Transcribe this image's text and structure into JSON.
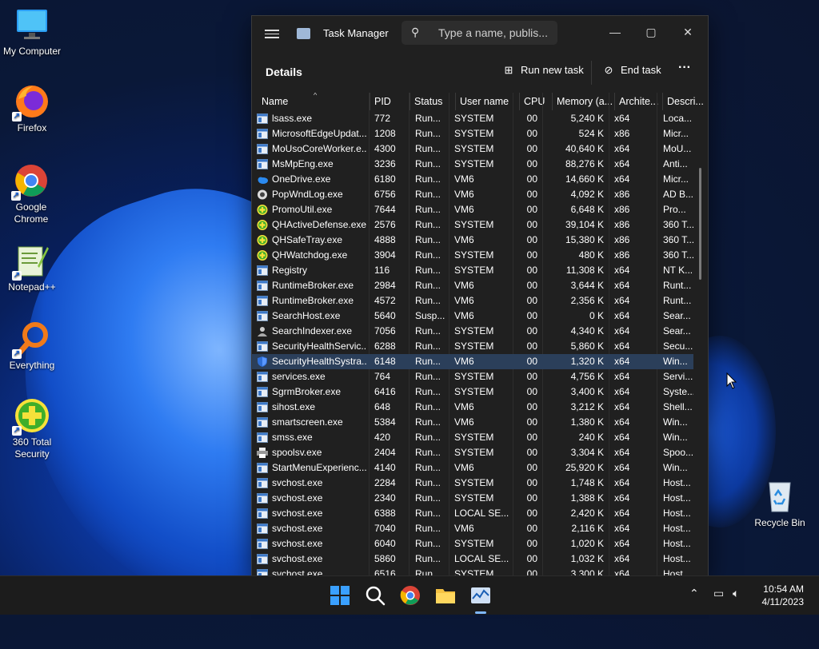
{
  "desktop": {
    "icons": [
      {
        "label": "My Computer"
      },
      {
        "label": "Firefox"
      },
      {
        "label": "Google Chrome"
      },
      {
        "label": "Notepad++"
      },
      {
        "label": "Everything"
      },
      {
        "label": "360 Total Security"
      },
      {
        "label": "Recycle Bin"
      }
    ]
  },
  "window": {
    "title": "Task Manager",
    "search_placeholder": "Type a name, publis...",
    "page_title": "Details",
    "run_new_task": "Run new task",
    "end_task": "End task",
    "more": "···",
    "minimize": "—",
    "maximize": "▢",
    "close": "✕"
  },
  "columns": [
    "Name",
    "PID",
    "Status",
    "User name",
    "CPU",
    "Memory (a...",
    "Archite...",
    "Descri..."
  ],
  "rows": [
    {
      "icon": "window",
      "name": "lsass.exe",
      "pid": "772",
      "status": "Run...",
      "user": "SYSTEM",
      "cpu": "00",
      "mem": "5,240 K",
      "arch": "x64",
      "desc": "Loca..."
    },
    {
      "icon": "window",
      "name": "MicrosoftEdgeUpdat...",
      "pid": "1208",
      "status": "Run...",
      "user": "SYSTEM",
      "cpu": "00",
      "mem": "524 K",
      "arch": "x86",
      "desc": "Micr..."
    },
    {
      "icon": "window",
      "name": "MoUsoCoreWorker.e...",
      "pid": "4300",
      "status": "Run...",
      "user": "SYSTEM",
      "cpu": "00",
      "mem": "40,640 K",
      "arch": "x64",
      "desc": "MoU..."
    },
    {
      "icon": "window",
      "name": "MsMpEng.exe",
      "pid": "3236",
      "status": "Run...",
      "user": "SYSTEM",
      "cpu": "00",
      "mem": "88,276 K",
      "arch": "x64",
      "desc": "Anti..."
    },
    {
      "icon": "cloud",
      "name": "OneDrive.exe",
      "pid": "6180",
      "status": "Run...",
      "user": "VM6",
      "cpu": "00",
      "mem": "14,660 K",
      "arch": "x64",
      "desc": "Micr..."
    },
    {
      "icon": "gear",
      "name": "PopWndLog.exe",
      "pid": "6756",
      "status": "Run...",
      "user": "VM6",
      "cpu": "00",
      "mem": "4,092 K",
      "arch": "x86",
      "desc": "AD B..."
    },
    {
      "icon": "plus",
      "name": "PromoUtil.exe",
      "pid": "7644",
      "status": "Run...",
      "user": "VM6",
      "cpu": "00",
      "mem": "6,648 K",
      "arch": "x86",
      "desc": "Pro..."
    },
    {
      "icon": "plus",
      "name": "QHActiveDefense.exe",
      "pid": "2576",
      "status": "Run...",
      "user": "SYSTEM",
      "cpu": "00",
      "mem": "39,104 K",
      "arch": "x86",
      "desc": "360 T..."
    },
    {
      "icon": "plus",
      "name": "QHSafeTray.exe",
      "pid": "4888",
      "status": "Run...",
      "user": "VM6",
      "cpu": "00",
      "mem": "15,380 K",
      "arch": "x86",
      "desc": "360 T..."
    },
    {
      "icon": "plus",
      "name": "QHWatchdog.exe",
      "pid": "3904",
      "status": "Run...",
      "user": "SYSTEM",
      "cpu": "00",
      "mem": "480 K",
      "arch": "x86",
      "desc": "360 T..."
    },
    {
      "icon": "window",
      "name": "Registry",
      "pid": "116",
      "status": "Run...",
      "user": "SYSTEM",
      "cpu": "00",
      "mem": "11,308 K",
      "arch": "x64",
      "desc": "NT K..."
    },
    {
      "icon": "window",
      "name": "RuntimeBroker.exe",
      "pid": "2984",
      "status": "Run...",
      "user": "VM6",
      "cpu": "00",
      "mem": "3,644 K",
      "arch": "x64",
      "desc": "Runt..."
    },
    {
      "icon": "window",
      "name": "RuntimeBroker.exe",
      "pid": "4572",
      "status": "Run...",
      "user": "VM6",
      "cpu": "00",
      "mem": "2,356 K",
      "arch": "x64",
      "desc": "Runt..."
    },
    {
      "icon": "window",
      "name": "SearchHost.exe",
      "pid": "5640",
      "status": "Susp...",
      "user": "VM6",
      "cpu": "00",
      "mem": "0 K",
      "arch": "x64",
      "desc": "Sear..."
    },
    {
      "icon": "person",
      "name": "SearchIndexer.exe",
      "pid": "7056",
      "status": "Run...",
      "user": "SYSTEM",
      "cpu": "00",
      "mem": "4,340 K",
      "arch": "x64",
      "desc": "Sear..."
    },
    {
      "icon": "window",
      "name": "SecurityHealthServic...",
      "pid": "6288",
      "status": "Run...",
      "user": "SYSTEM",
      "cpu": "00",
      "mem": "5,860 K",
      "arch": "x64",
      "desc": "Secu..."
    },
    {
      "icon": "shield",
      "name": "SecurityHealthSystra...",
      "pid": "6148",
      "status": "Run...",
      "user": "VM6",
      "cpu": "00",
      "mem": "1,320 K",
      "arch": "x64",
      "desc": "Win...",
      "selected": true
    },
    {
      "icon": "window",
      "name": "services.exe",
      "pid": "764",
      "status": "Run...",
      "user": "SYSTEM",
      "cpu": "00",
      "mem": "4,756 K",
      "arch": "x64",
      "desc": "Servi..."
    },
    {
      "icon": "window",
      "name": "SgrmBroker.exe",
      "pid": "6416",
      "status": "Run...",
      "user": "SYSTEM",
      "cpu": "00",
      "mem": "3,400 K",
      "arch": "x64",
      "desc": "Syste..."
    },
    {
      "icon": "window",
      "name": "sihost.exe",
      "pid": "648",
      "status": "Run...",
      "user": "VM6",
      "cpu": "00",
      "mem": "3,212 K",
      "arch": "x64",
      "desc": "Shell..."
    },
    {
      "icon": "window",
      "name": "smartscreen.exe",
      "pid": "5384",
      "status": "Run...",
      "user": "VM6",
      "cpu": "00",
      "mem": "1,380 K",
      "arch": "x64",
      "desc": "Win..."
    },
    {
      "icon": "window",
      "name": "smss.exe",
      "pid": "420",
      "status": "Run...",
      "user": "SYSTEM",
      "cpu": "00",
      "mem": "240 K",
      "arch": "x64",
      "desc": "Win..."
    },
    {
      "icon": "printer",
      "name": "spoolsv.exe",
      "pid": "2404",
      "status": "Run...",
      "user": "SYSTEM",
      "cpu": "00",
      "mem": "3,304 K",
      "arch": "x64",
      "desc": "Spoo..."
    },
    {
      "icon": "window",
      "name": "StartMenuExperienc...",
      "pid": "4140",
      "status": "Run...",
      "user": "VM6",
      "cpu": "00",
      "mem": "25,920 K",
      "arch": "x64",
      "desc": "Win..."
    },
    {
      "icon": "window",
      "name": "svchost.exe",
      "pid": "2284",
      "status": "Run...",
      "user": "SYSTEM",
      "cpu": "00",
      "mem": "1,748 K",
      "arch": "x64",
      "desc": "Host..."
    },
    {
      "icon": "window",
      "name": "svchost.exe",
      "pid": "2340",
      "status": "Run...",
      "user": "SYSTEM",
      "cpu": "00",
      "mem": "1,388 K",
      "arch": "x64",
      "desc": "Host..."
    },
    {
      "icon": "window",
      "name": "svchost.exe",
      "pid": "6388",
      "status": "Run...",
      "user": "LOCAL SE...",
      "cpu": "00",
      "mem": "2,420 K",
      "arch": "x64",
      "desc": "Host..."
    },
    {
      "icon": "window",
      "name": "svchost.exe",
      "pid": "7040",
      "status": "Run...",
      "user": "VM6",
      "cpu": "00",
      "mem": "2,116 K",
      "arch": "x64",
      "desc": "Host..."
    },
    {
      "icon": "window",
      "name": "svchost.exe",
      "pid": "6040",
      "status": "Run...",
      "user": "SYSTEM",
      "cpu": "00",
      "mem": "1,020 K",
      "arch": "x64",
      "desc": "Host..."
    },
    {
      "icon": "window",
      "name": "svchost.exe",
      "pid": "5860",
      "status": "Run...",
      "user": "LOCAL SE...",
      "cpu": "00",
      "mem": "1,032 K",
      "arch": "x64",
      "desc": "Host..."
    },
    {
      "icon": "window",
      "name": "svchost.exe",
      "pid": "6516",
      "status": "Run...",
      "user": "SYSTEM",
      "cpu": "00",
      "mem": "3,300 K",
      "arch": "x64",
      "desc": "Host..."
    }
  ],
  "taskbar": {
    "time": "10:54 AM",
    "date": "4/11/2023",
    "apps": [
      "start-icon",
      "search-icon",
      "chrome-icon",
      "file-explorer-icon",
      "task-manager-icon"
    ]
  },
  "colors": {
    "window_bg": "#202020",
    "selection": "#2b3f5a",
    "taskbar_bg": "#1c1c1c",
    "accent": "#1a73e8"
  }
}
